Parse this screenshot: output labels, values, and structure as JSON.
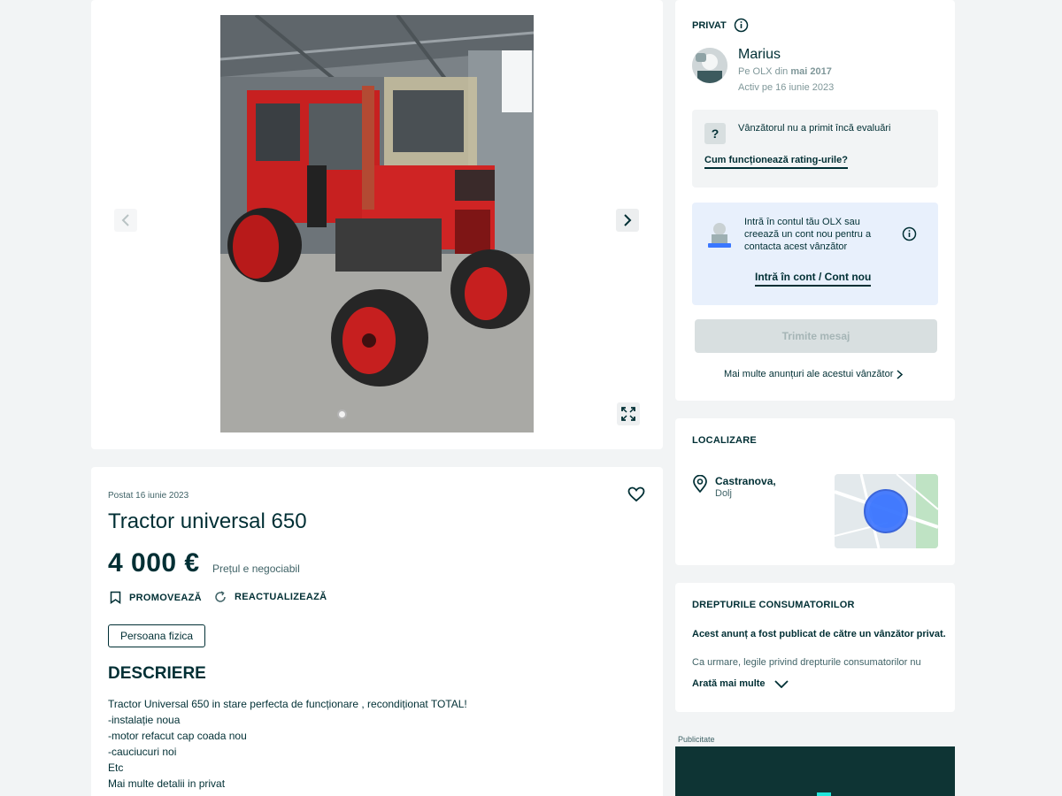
{
  "gallery": {
    "prev_icon": "chevron-left-icon",
    "next_icon": "chevron-right-icon",
    "expand_icon": "expand-icon"
  },
  "ad": {
    "posted": "Postat 16 iunie 2023",
    "title": "Tractor universal 650",
    "price": "4 000 €",
    "negotiable": "Prețul e negociabil",
    "promote_label": "PROMOVEAZĂ",
    "refresh_label": "REACTUALIZEAZĂ",
    "seller_type_tag": "Persoana fizica",
    "description_heading": "DESCRIERE",
    "description": "Tractor Universal 650 in stare perfecta de funcționare , recondiționat TOTAL!\n-instalație noua\n-motor refacut cap coada nou\n-cauciucuri noi\nEtc\nMai multe detalii in privat"
  },
  "seller": {
    "type_label": "PRIVAT",
    "name": "Marius",
    "since_prefix": "Pe OLX din ",
    "since_date": "mai 2017",
    "active": "Activ pe 16 iunie 2023",
    "no_ratings": "Vânzătorul nu a primit încă evaluări",
    "ratings_link": "Cum funcționează rating-urile?",
    "login_text": "Intră în contul tău OLX sau creează un cont nou pentru a contacta acest vânzător",
    "login_link": "Intră în cont / Cont nou",
    "send_button": "Trimite mesaj",
    "more_ads": "Mai multe anunțuri ale acestui vânzător"
  },
  "location": {
    "heading": "LOCALIZARE",
    "city": "Castranova,",
    "county": "Dolj"
  },
  "rights": {
    "heading": "DREPTURILE CONSUMATORILOR",
    "bold_text": "Acest anunț a fost publicat de către un vânzător privat.",
    "text": "Ca urmare, legile privind drepturile consumatorilor nu",
    "show_more": "Arată mai multe"
  },
  "advert": {
    "label": "Publicitate"
  },
  "colors": {
    "text": "#002f34",
    "background": "#f2f4f5",
    "login_box": "#e8f0fc",
    "ad_dark": "#0e3434",
    "accent": "#23e5db"
  }
}
